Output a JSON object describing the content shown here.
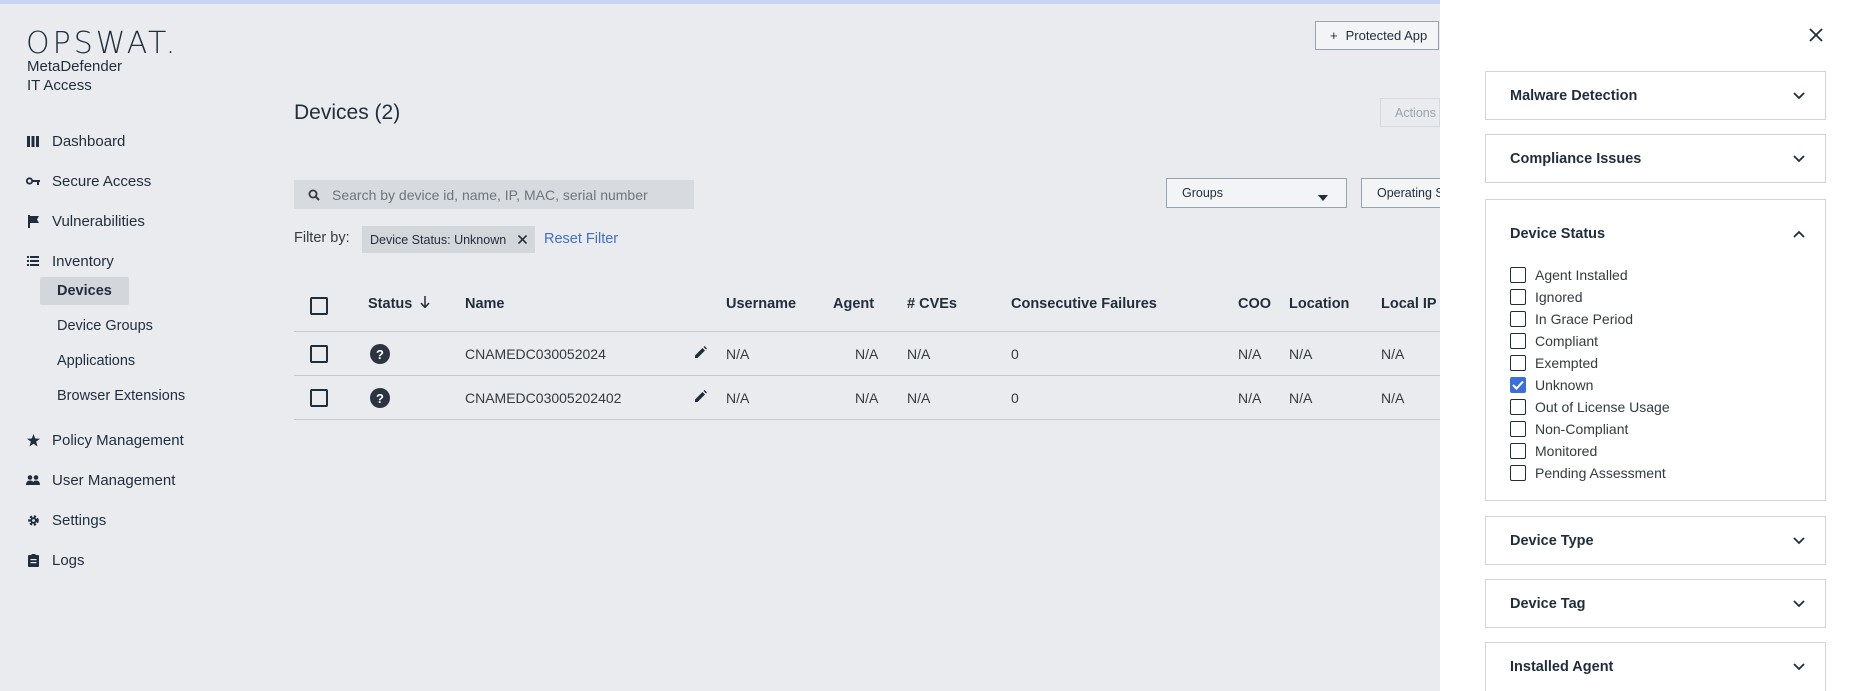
{
  "app": {
    "logo": "OPSWAT.",
    "product_line1": "MetaDefender",
    "product_line2": "IT Access"
  },
  "nav": {
    "dashboard": "Dashboard",
    "secure_access": "Secure Access",
    "vulnerabilities": "Vulnerabilities",
    "inventory": "Inventory",
    "inventory_children": [
      "Devices",
      "Device Groups",
      "Applications",
      "Browser Extensions"
    ],
    "policy_management": "Policy Management",
    "user_management": "User Management",
    "settings": "Settings",
    "logs": "Logs"
  },
  "header": {
    "protected_app_button": "Protected App",
    "actions_button": "Actions"
  },
  "page": {
    "title": "Devices (2)"
  },
  "search": {
    "placeholder": "Search by device id, name, IP, MAC, serial number"
  },
  "filters": {
    "groups_select": "Groups",
    "os_select": "Operating S",
    "filter_by_label": "Filter by:",
    "active_chip": "Device Status: Unknown",
    "reset": "Reset Filter"
  },
  "table": {
    "columns": [
      "Status",
      "Name",
      "Username",
      "Agent",
      "# CVEs",
      "Consecutive Failures",
      "COO",
      "Location",
      "Local IP"
    ],
    "rows": [
      {
        "name": "CNAMEDC030052024",
        "username": "N/A",
        "agent": "N/A",
        "cves": "N/A",
        "failures": "0",
        "coo": "N/A",
        "location": "N/A",
        "local_ip": "N/A"
      },
      {
        "name": "CNAMEDC03005202402",
        "username": "N/A",
        "agent": "N/A",
        "cves": "N/A",
        "failures": "0",
        "coo": "N/A",
        "location": "N/A",
        "local_ip": "N/A"
      }
    ]
  },
  "panel": {
    "sections": {
      "malware": "Malware Detection",
      "compliance": "Compliance Issues",
      "device_status": "Device Status",
      "device_type": "Device Type",
      "device_tag": "Device Tag",
      "installed_agent": "Installed Agent"
    },
    "status_options": [
      {
        "label": "Agent Installed",
        "checked": false
      },
      {
        "label": "Ignored",
        "checked": false
      },
      {
        "label": "In Grace Period",
        "checked": false
      },
      {
        "label": "Compliant",
        "checked": false
      },
      {
        "label": "Exempted",
        "checked": false
      },
      {
        "label": "Unknown",
        "checked": true
      },
      {
        "label": "Out of License Usage",
        "checked": false
      },
      {
        "label": "Non-Compliant",
        "checked": false
      },
      {
        "label": "Monitored",
        "checked": false
      },
      {
        "label": "Pending Assessment",
        "checked": false
      }
    ]
  },
  "colors": {
    "accent": "#3d6fd8",
    "link": "#3f6fd1",
    "background": "#e9ebee"
  }
}
